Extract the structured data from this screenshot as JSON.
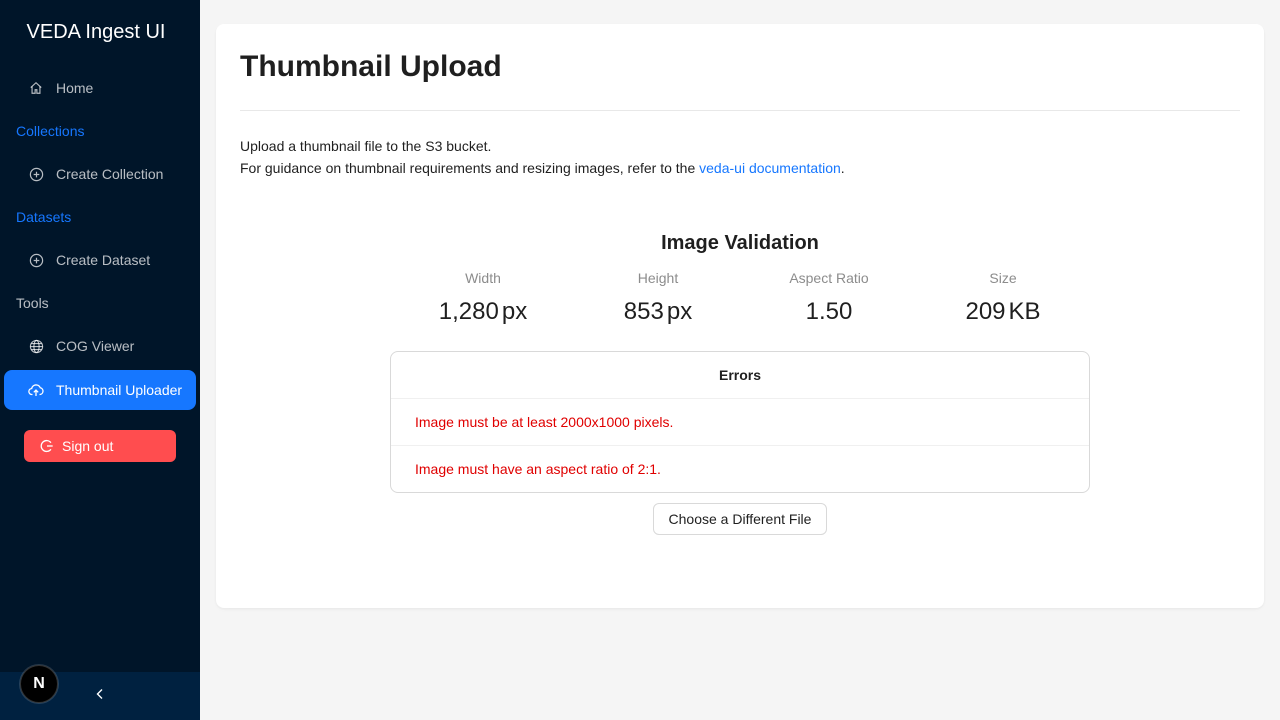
{
  "app": {
    "title": "VEDA Ingest UI"
  },
  "sidebar": {
    "home": {
      "label": "Home",
      "icon": "home-icon"
    },
    "collections_title": "Collections",
    "create_collection": {
      "label": "Create Collection",
      "icon": "plus-circle-icon"
    },
    "datasets_title": "Datasets",
    "create_dataset": {
      "label": "Create Dataset",
      "icon": "plus-circle-icon"
    },
    "tools_title": "Tools",
    "cog_viewer": {
      "label": "COG Viewer",
      "icon": "globe-icon"
    },
    "thumbnail_uploader": {
      "label": "Thumbnail Uploader",
      "icon": "cloud-upload-icon",
      "active": true
    },
    "sign_out": {
      "label": "Sign out",
      "icon": "logout-icon"
    },
    "collapse_icon": "chevron-left-icon",
    "badge_letter": "N"
  },
  "main": {
    "title": "Thumbnail Upload",
    "intro_line1": "Upload a thumbnail file to the S3 bucket.",
    "intro_line2_prefix": "For guidance on thumbnail requirements and resizing images, refer to the ",
    "intro_link": "veda-ui documentation",
    "intro_line2_suffix": "."
  },
  "validation": {
    "title": "Image Validation",
    "stats": [
      {
        "label": "Width",
        "value": "1,280",
        "unit": "px"
      },
      {
        "label": "Height",
        "value": "853",
        "unit": "px"
      },
      {
        "label": "Aspect Ratio",
        "value": "1.50",
        "unit": ""
      },
      {
        "label": "Size",
        "value": "209",
        "unit": "KB"
      }
    ],
    "errors_title": "Errors",
    "errors": [
      "Image must be at least 2000x1000 pixels.",
      "Image must have an aspect ratio of 2:1."
    ],
    "choose_button": "Choose a Different File"
  },
  "colors": {
    "sidebar_bg": "#001529",
    "accent": "#1677ff",
    "danger": "#ff4d4f",
    "error_text": "#e00000"
  }
}
